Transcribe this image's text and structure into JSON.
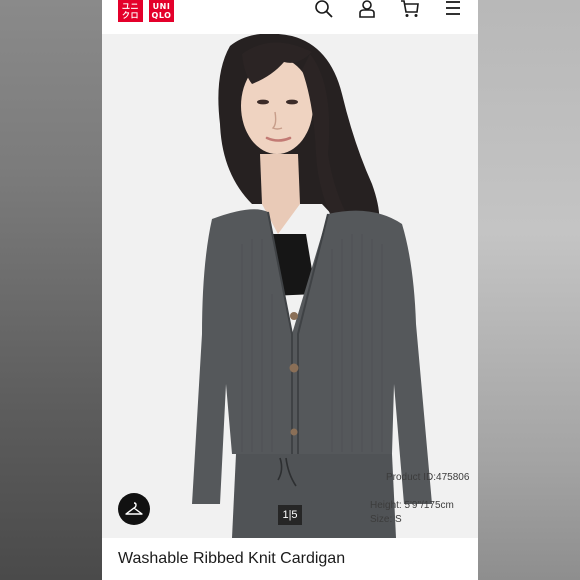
{
  "brand": {
    "logo_left_top": "ユニ",
    "logo_left_bottom": "クロ",
    "logo_right_top": "UNI",
    "logo_right_bottom": "QLO"
  },
  "nav": {
    "icons": [
      "search-icon",
      "account-icon",
      "cart-icon",
      "menu-icon"
    ]
  },
  "product": {
    "title": "Washable Ribbed Knit Cardigan",
    "product_id": "Product ID:475806",
    "height": "Height: 5'9\"/175cm",
    "size": "Size: S"
  },
  "gallery": {
    "pager": "1|5"
  },
  "colors": {
    "brand_red": "#e4002b",
    "sweater_gray": "#55585b"
  }
}
